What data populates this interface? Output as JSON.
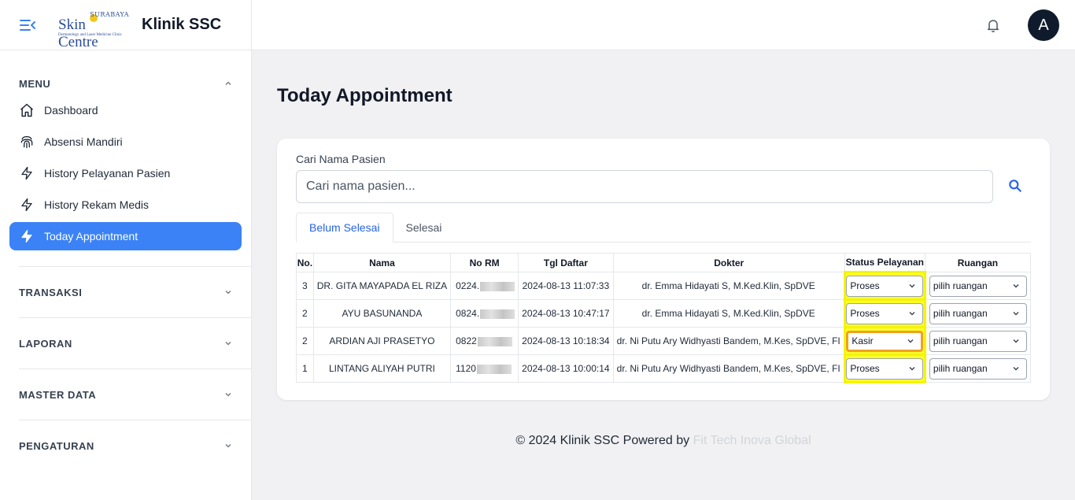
{
  "brand": {
    "logo_top": "SURABAYA",
    "logo_main": "Skin Centre",
    "logo_sub": "Dermatology and Laser Medicine Clinic",
    "name": "Klinik SSC"
  },
  "sidebar": {
    "menu_heading": "MENU",
    "items": [
      {
        "label": "Dashboard",
        "icon": "home-icon"
      },
      {
        "label": "Absensi Mandiri",
        "icon": "fingerprint-icon"
      },
      {
        "label": "History Pelayanan Pasien",
        "icon": "bolt-icon"
      },
      {
        "label": "History Rekam Medis",
        "icon": "bolt-icon"
      },
      {
        "label": "Today Appointment",
        "icon": "bolt-icon",
        "active": true
      }
    ],
    "sections": [
      "TRANSAKSI",
      "LAPORAN",
      "MASTER DATA",
      "PENGATURAN"
    ]
  },
  "topbar": {
    "avatar_initial": "A"
  },
  "page": {
    "title": "Today Appointment"
  },
  "search": {
    "label": "Cari Nama Pasien",
    "placeholder": "Cari nama pasien...",
    "value": ""
  },
  "tabs": [
    {
      "label": "Belum Selesai",
      "active": true
    },
    {
      "label": "Selesai",
      "active": false
    }
  ],
  "table": {
    "headers": [
      "No.",
      "Nama",
      "No RM",
      "Tgl Daftar",
      "Dokter",
      "Status Pelayanan",
      "Ruangan"
    ],
    "rows": [
      {
        "no": "3",
        "nama": "DR. GITA MAYAPADA EL RIZA",
        "rm": "0224.",
        "tgl": "2024-08-13 11:07:33",
        "dokter": "dr. Emma Hidayati S, M.Ked.Klin, SpDVE",
        "status": "Proses",
        "ruangan": "pilih ruangan"
      },
      {
        "no": "2",
        "nama": "AYU BASUNANDA",
        "rm": "0824.",
        "tgl": "2024-08-13 10:47:17",
        "dokter": "dr. Emma Hidayati S, M.Ked.Klin, SpDVE",
        "status": "Proses",
        "ruangan": "pilih ruangan"
      },
      {
        "no": "2",
        "nama": "ARDIAN AJI PRASETYO",
        "rm": "0822",
        "tgl": "2024-08-13 10:18:34",
        "dokter": "dr. Ni Putu Ary Widhyasti Bandem, M.Kes, SpDVE, FI",
        "status": "Kasir",
        "ruangan": "pilih ruangan"
      },
      {
        "no": "1",
        "nama": "LINTANG ALIYAH PUTRI",
        "rm": "1120",
        "tgl": "2024-08-13 10:00:14",
        "dokter": "dr. Ni Putu Ary Widhyasti Bandem, M.Kes, SpDVE, FI",
        "status": "Proses",
        "ruangan": "pilih ruangan"
      }
    ]
  },
  "footer": {
    "text": "© 2024 Klinik SSC Powered by",
    "link": "Fit Tech Inova Global"
  },
  "colors": {
    "accent": "#3b82f6",
    "status_highlight": "#f4f40a",
    "kasir_border": "#f0a020"
  }
}
